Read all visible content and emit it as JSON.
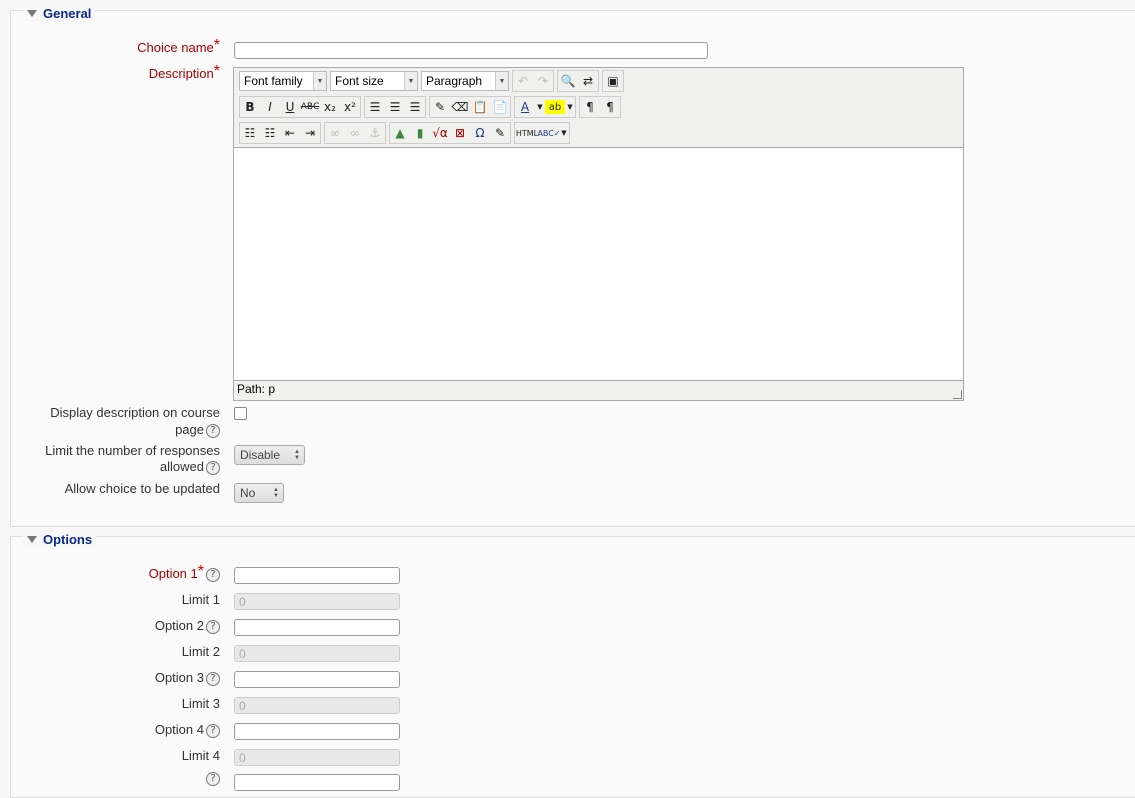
{
  "general": {
    "legend": "General",
    "choice_name_label": "Choice name",
    "description_label": "Description",
    "editor": {
      "font_family": "Font family",
      "font_size": "Font size",
      "paragraph": "Paragraph",
      "path": "Path: p"
    },
    "display_desc_label_1": "Display description on course",
    "display_desc_label_2": "page",
    "limit_label_1": "Limit the number of responses",
    "limit_label_2": "allowed",
    "limit_value": "Disable",
    "allow_update_label": "Allow choice to be updated",
    "allow_update_value": "No"
  },
  "options": {
    "legend": "Options",
    "items": [
      {
        "option_label": "Option 1",
        "limit_label": "Limit 1",
        "limit_value": "0"
      },
      {
        "option_label": "Option 2",
        "limit_label": "Limit 2",
        "limit_value": "0"
      },
      {
        "option_label": "Option 3",
        "limit_label": "Limit 3",
        "limit_value": "0"
      },
      {
        "option_label": "Option 4",
        "limit_label": "Limit 4",
        "limit_value": "0"
      }
    ]
  },
  "colors": {
    "legend": "#0a2a8f",
    "required": "#aa0000"
  }
}
